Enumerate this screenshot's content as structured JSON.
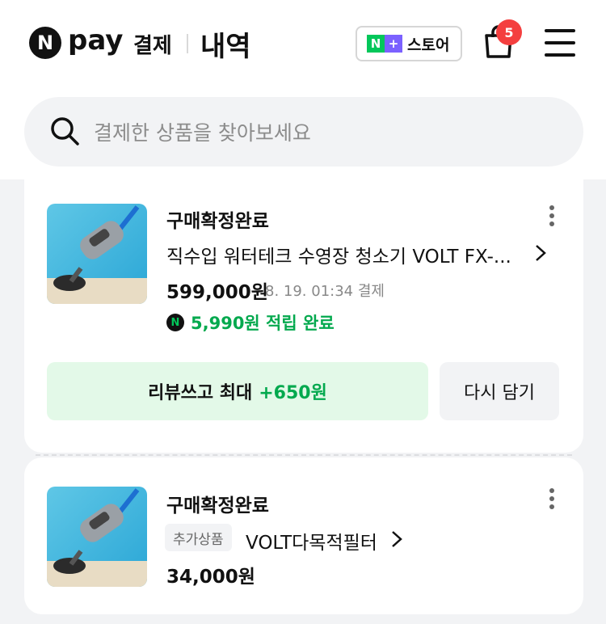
{
  "header": {
    "logo_mark": "N",
    "logo_pay": "pay",
    "logo_sub": "결제",
    "title": "내역",
    "store": {
      "badge_n": "N",
      "badge_plus": "+",
      "label": "스토어"
    },
    "cart_count": "5"
  },
  "search": {
    "placeholder": "결제한 상품을 찾아보세요"
  },
  "orders": [
    {
      "status": "구매확정완료",
      "product_name": "직수입 워터테크 수영장 청소기 VOLT FX-...",
      "price": "599,000원",
      "date": "8. 19. 01:34 결제",
      "reward_icon": "N",
      "reward": "5,990원 적립 완료",
      "review_label": "리뷰쓰고 최대",
      "review_amount": "+650원",
      "reorder_label": "다시 담기"
    },
    {
      "status": "구매확정완료",
      "tag": "추가상품",
      "product_name": "VOLT다목적필터",
      "price": "34,000원"
    }
  ],
  "colors": {
    "accent_green": "#03c75a",
    "badge_red": "#f43f3f",
    "store_purple": "#7b61ff"
  },
  "icons": [
    "naver-n-logo",
    "cart-icon",
    "menu-icon",
    "search-icon",
    "more-vertical-icon",
    "chevron-right-icon",
    "naver-pay-point-icon"
  ]
}
